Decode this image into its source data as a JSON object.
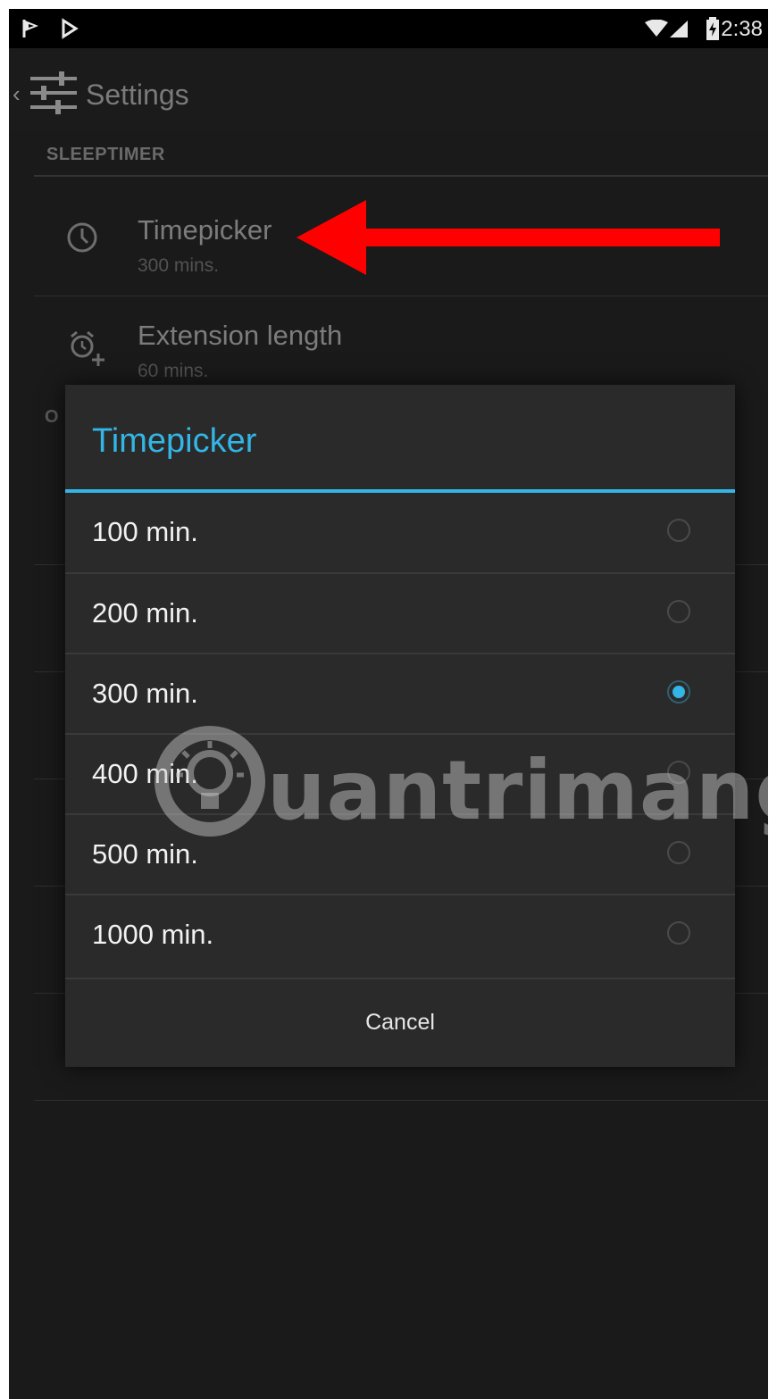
{
  "status_bar": {
    "time": "2:38",
    "left_icons": [
      "notification-flag-icon",
      "play-store-icon"
    ],
    "right_icons": [
      "wifi-icon",
      "signal-icon",
      "battery-icon"
    ]
  },
  "action_bar": {
    "title": "Settings",
    "icon": "settings-sliders-icon"
  },
  "background_settings": {
    "section_header": "SLEEPTIMER",
    "section2_header_fragment": "O",
    "items": [
      {
        "title": "Timepicker",
        "summary": "300 mins.",
        "icon": "clock-icon"
      },
      {
        "title": "Extension length",
        "summary": "60 mins.",
        "icon": "alarm-add-icon"
      }
    ]
  },
  "dialog": {
    "title": "Timepicker",
    "options": [
      {
        "label": "100 min.",
        "selected": false
      },
      {
        "label": "200 min.",
        "selected": false
      },
      {
        "label": "300 min.",
        "selected": true
      },
      {
        "label": "400 min.",
        "selected": false
      },
      {
        "label": "500 min.",
        "selected": false
      },
      {
        "label": "1000 min.",
        "selected": false
      }
    ],
    "cancel_label": "Cancel"
  },
  "annotation": {
    "arrow_color": "#ff0000"
  },
  "watermark": {
    "text": "uantrimang"
  },
  "colors": {
    "accent": "#33b5e5",
    "background": "#0e0e0e",
    "dialog": "#2a2a2a"
  }
}
